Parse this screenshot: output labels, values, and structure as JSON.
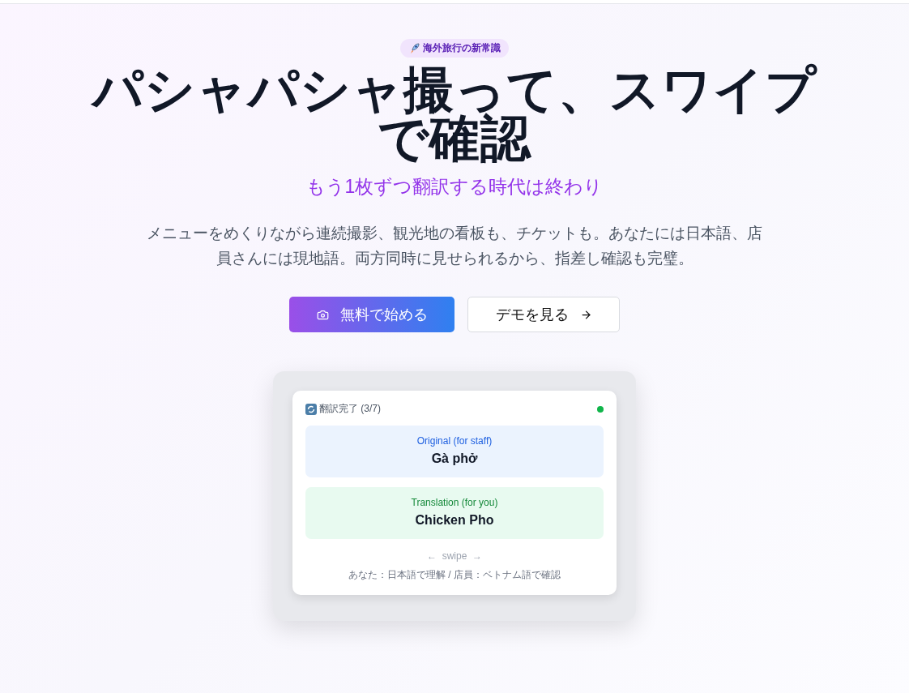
{
  "hero": {
    "badge": "海外旅行の新常識",
    "title": "パシャパシャ撮って、スワイプで確認",
    "subtitle": "もう1枚ずつ翻訳する時代は終わり",
    "description": "メニューをめくりながら連続撮影、観光地の看板も、チケットも。あなたには日本語、店員さんには現地語。両方同時に見せられるから、指差し確認も完璧。"
  },
  "buttons": [
    {
      "kind": "primary",
      "label": "無料で始める"
    },
    {
      "kind": "secondary",
      "label": "デモを見る"
    }
  ],
  "demo_card": {
    "status": "翻訳完了 (3/7)",
    "online": true,
    "panels": [
      {
        "kind": "original",
        "label": "Original (for staff)",
        "text": "Gà phở"
      },
      {
        "kind": "translation",
        "label": "Translation (for you)",
        "text": "Chicken Pho"
      }
    ],
    "swipe_hint": "←  swipe  →",
    "footer": "あなた：日本語で理解 / 店員：ベトナム語で確認"
  }
}
